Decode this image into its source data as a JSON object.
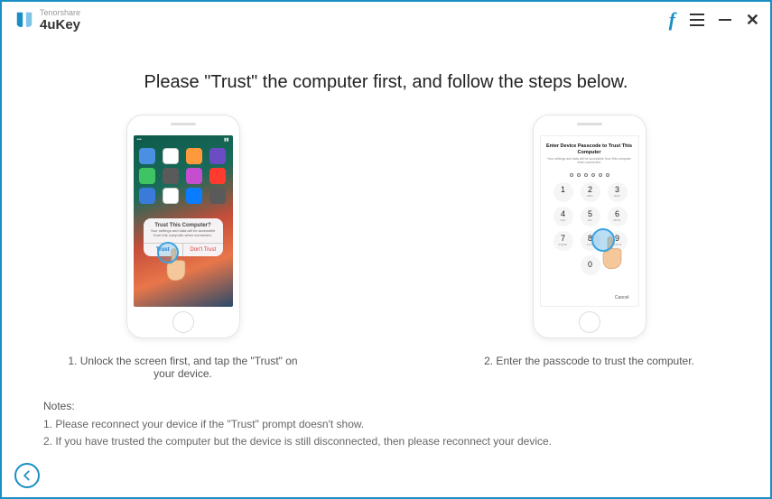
{
  "brand": {
    "company": "Tenorshare",
    "product": "4uKey"
  },
  "heading": "Please \"Trust\" the computer first, and follow the steps below.",
  "phone1": {
    "dialog_title": "Trust This Computer?",
    "dialog_msg": "Your settings and data will be accessible from this computer when connected.",
    "btn_trust": "Trust",
    "btn_dont": "Don't Trust",
    "caption": "1. Unlock the screen first, and tap the \"Trust\" on your device."
  },
  "phone2": {
    "title": "Enter Device Passcode to Trust This Computer",
    "sub": "Your settings and data will be accessible from this computer when connected.",
    "keys": [
      "1",
      "2",
      "3",
      "4",
      "5",
      "6",
      "7",
      "8",
      "9",
      "0"
    ],
    "letters": [
      "",
      "ABC",
      "DEF",
      "GHI",
      "JKL",
      "MNO",
      "PQRS",
      "TUV",
      "WXYZ",
      ""
    ],
    "cancel": "Cancel",
    "caption": "2. Enter the passcode to trust the computer."
  },
  "notes": {
    "title": "Notes:",
    "line1": "1. Please reconnect your device if the \"Trust\" prompt doesn't show.",
    "line2": "2. If you have trusted the computer but the device is still disconnected, then please reconnect your device."
  },
  "icons": {
    "facebook": "f",
    "close": "✕"
  },
  "app_colors": [
    "#4a90e2",
    "#ffffff",
    "#ff9a3c",
    "#6a4cc4",
    "#40c463",
    "#5a5a5a",
    "#c44dd0",
    "#ff3b30",
    "#3a7ad9",
    "#ffffff",
    "#0a7cff",
    "#5a5a5a"
  ]
}
